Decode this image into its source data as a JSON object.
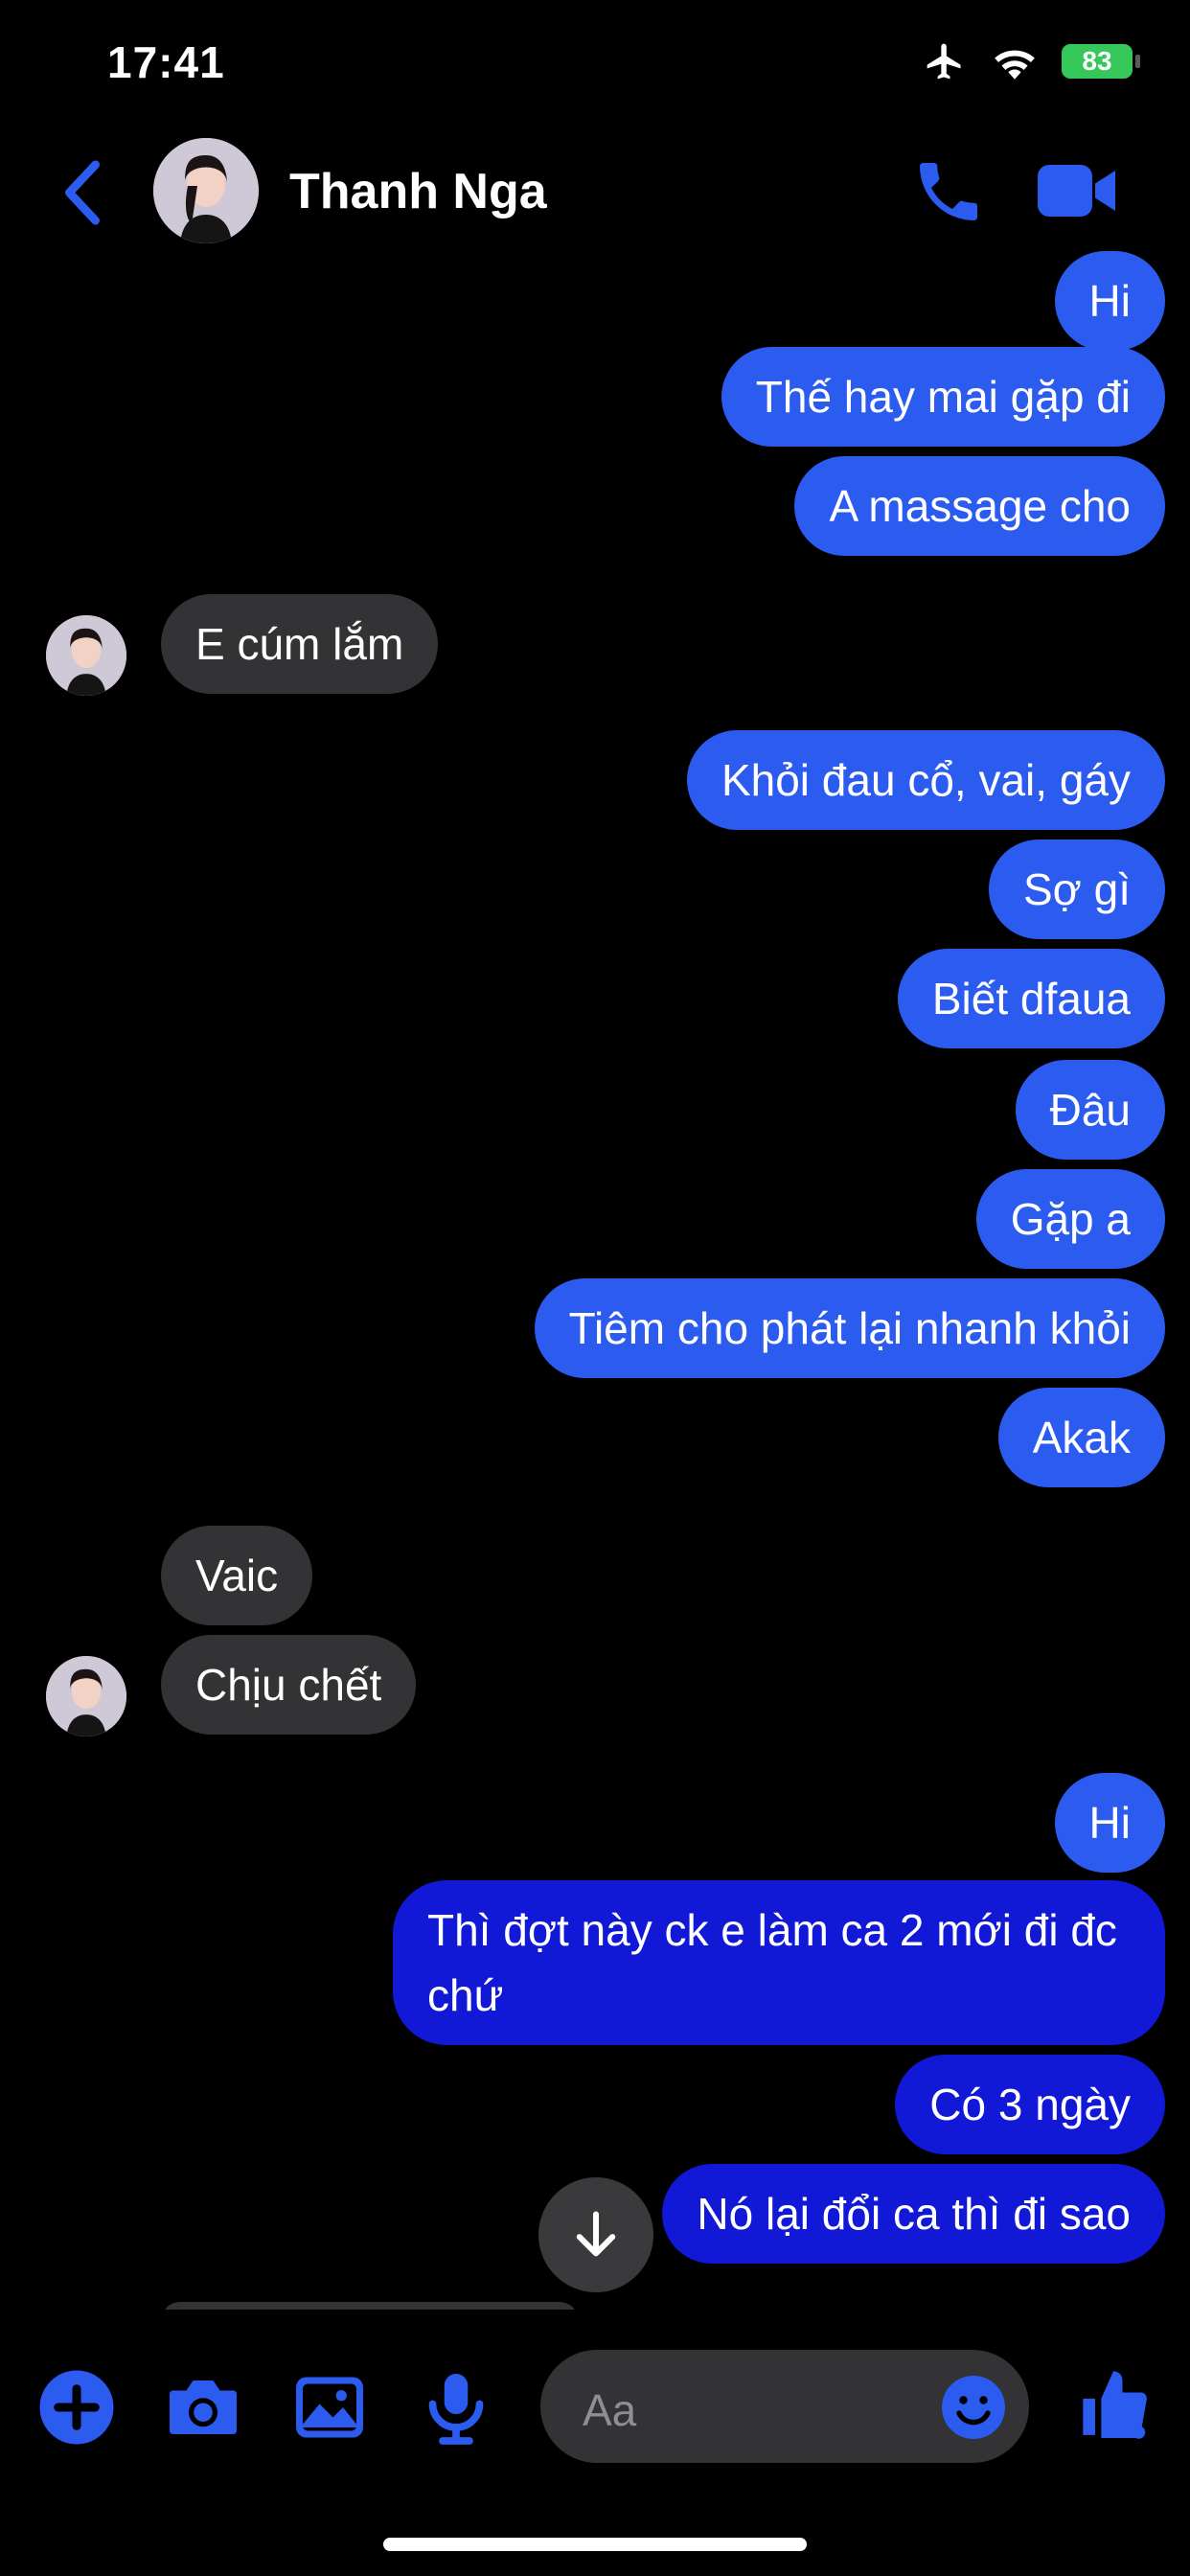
{
  "status": {
    "time": "17:41",
    "battery": "83"
  },
  "header": {
    "contact_name": "Thanh Nga"
  },
  "messages": [
    {
      "text": "Hi"
    },
    {
      "text": "Thế hay mai gặp đi"
    },
    {
      "text": "A massage cho"
    },
    {
      "text": "E cúm lắm"
    },
    {
      "text": "Khỏi đau cổ, vai, gáy"
    },
    {
      "text": "Sợ gì"
    },
    {
      "text": "Biết dfaua"
    },
    {
      "text": "Đâu"
    },
    {
      "text": "Gặp a"
    },
    {
      "text": "Tiêm cho phát lại nhanh khỏi"
    },
    {
      "text": "Akak"
    },
    {
      "text": "Vaic"
    },
    {
      "text": "Chịu chết"
    },
    {
      "text": "Hi"
    },
    {
      "text": "Thì đợt này ck e làm ca 2 mới đi đc chứ"
    },
    {
      "text": "Có 3 ngày"
    },
    {
      "text": "Nó lại đổi ca thì đi sao"
    }
  ],
  "composer": {
    "placeholder": "Aa"
  },
  "colors": {
    "accent": "#2c5bf0",
    "outgoing_dark": "#1118d6",
    "incoming": "#333335"
  },
  "icons": [
    "back-arrow-icon",
    "phone-icon",
    "video-camera-icon",
    "arrow-down-icon",
    "plus-icon",
    "camera-icon",
    "image-icon",
    "microphone-icon",
    "emoji-icon",
    "thumbs-up-icon",
    "airplane-icon",
    "wifi-icon",
    "battery-icon"
  ]
}
